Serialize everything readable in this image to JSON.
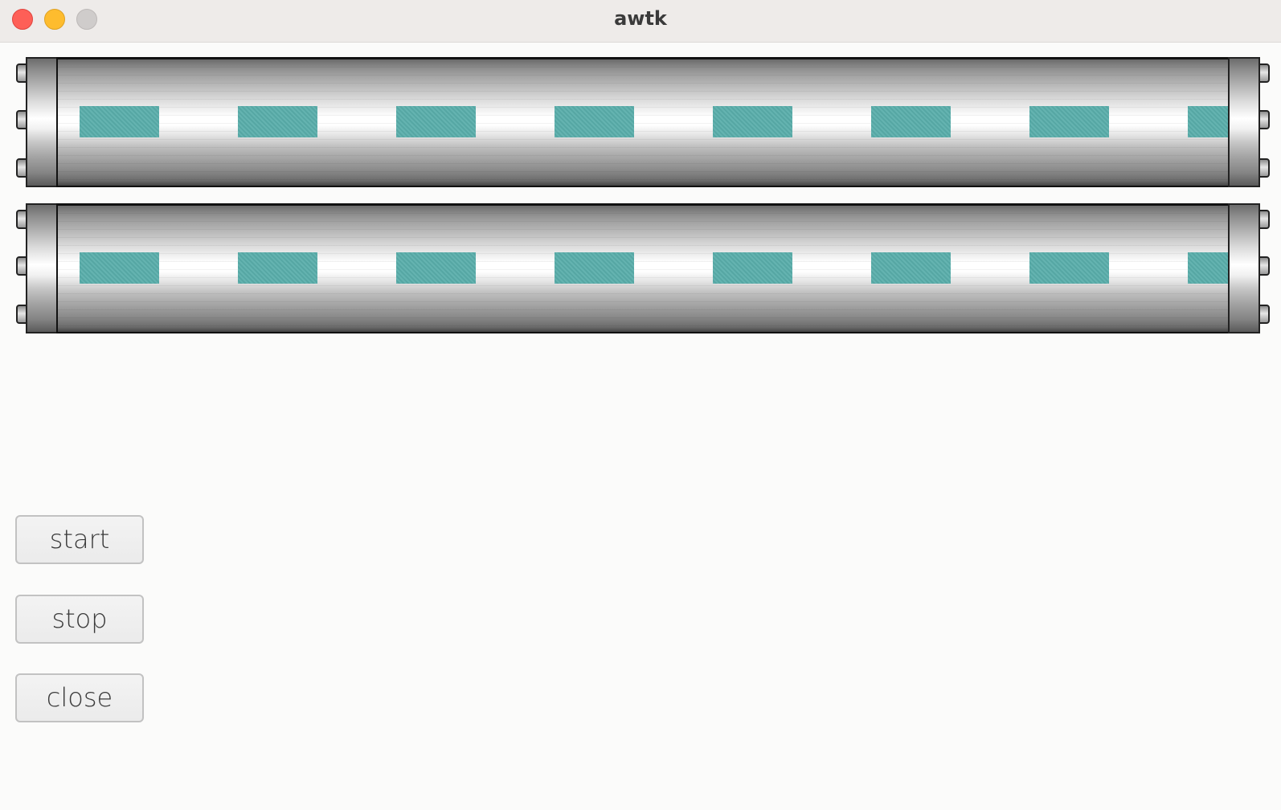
{
  "window": {
    "title": "awtk"
  },
  "conveyors": [
    {
      "boxes_visible": 8
    },
    {
      "boxes_visible": 8
    }
  ],
  "buttons": {
    "start_label": "start",
    "stop_label": "stop",
    "close_label": "close"
  },
  "colors": {
    "box": "#5aaeab",
    "traffic_close": "#fe5f57",
    "traffic_minimize": "#febc2e",
    "traffic_zoom": "#cfcccb"
  }
}
